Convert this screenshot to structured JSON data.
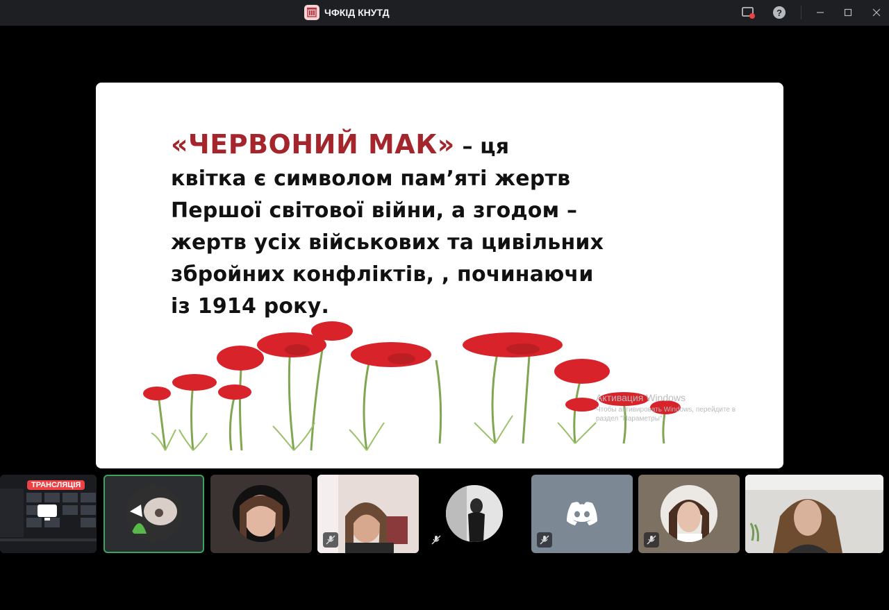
{
  "window": {
    "title": "ЧФКІД КНУТД"
  },
  "slide": {
    "title": "«ЧЕРВОНИЙ МАК»",
    "line1_rest": " – ця",
    "lines": [
      "квітка є символом пам’яті жертв",
      "Першої світової війни, а згодом –",
      "жертв усіх військових та цивільних",
      "збройних конфліктів, , починаючи",
      "із 1914 року."
    ],
    "watermark": {
      "line1": "Активация Windows",
      "line2": "Чтобы активировать Windows, перейдите в",
      "line3": "раздел \"Параметры\"."
    }
  },
  "participants": {
    "stream_badge": "ТРАНСЛЯЦІЯ",
    "tiles": [
      {
        "kind": "stream",
        "icon": "screen-share-icon"
      },
      {
        "kind": "avatar",
        "speaking": true
      },
      {
        "kind": "avatar"
      },
      {
        "kind": "video",
        "muted": true
      },
      {
        "kind": "avatar",
        "muted": true
      },
      {
        "kind": "default-avatar",
        "icon": "discord-icon",
        "muted": true
      },
      {
        "kind": "avatar",
        "muted": true
      },
      {
        "kind": "video"
      }
    ]
  },
  "colors": {
    "titlebar": "#1e1f22",
    "speaking": "#3ba55d",
    "live": "#ed4245",
    "slide_title": "#a4262c"
  }
}
